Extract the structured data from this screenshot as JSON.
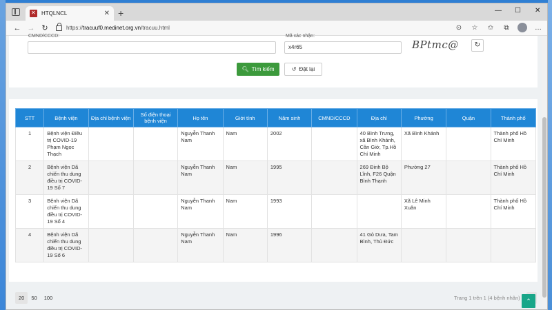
{
  "browser": {
    "tab_title": "HTQLNCL",
    "url_prefix": "https://",
    "url_host": "tracuuf0.medinet.org.vn",
    "url_path": "/tracuu.html",
    "win_min": "—",
    "win_max": "☐",
    "win_close": "✕"
  },
  "search_form": {
    "id_label": "CMND/CCCD:",
    "id_value": "",
    "captcha_label": "Mã xác nhận:",
    "captcha_value": "x4r65",
    "captcha_text": "BPtmc@",
    "search_button": "Tìm kiếm",
    "reset_button": "Đặt lại"
  },
  "table": {
    "headers": [
      "STT",
      "Bệnh viện",
      "Địa chỉ bệnh viện",
      "Số điện thoại bệnh viện",
      "Họ tên",
      "Giới tính",
      "Năm sinh",
      "CMND/CCCD",
      "Địa chỉ",
      "Phường",
      "Quận",
      "Thành phố"
    ],
    "rows": [
      [
        "1",
        "Bệnh viện Điều trị COVID-19 Phạm Ngọc Thạch",
        "",
        "",
        "Nguyễn Thanh Nam",
        "Nam",
        "2002",
        "",
        "40 Bình Trưng, xã Bình Khánh, Cần Giờ, Tp.Hồ Chí Minh",
        "Xã Bình Khánh",
        "",
        "Thành phố Hồ Chí Minh"
      ],
      [
        "2",
        "Bệnh viện Dã chiến thu dung điều trị COVID-19 Số 7",
        "",
        "",
        "Nguyễn Thanh Nam",
        "Nam",
        "1995",
        "",
        "269 Đinh Bộ Lĩnh, F26 Quận Bình Thạnh",
        "Phường 27",
        "",
        "Thành phố Hồ Chí Minh"
      ],
      [
        "3",
        "Bệnh viện Dã chiến thu dung điều trị COVID-19 Số 4",
        "",
        "",
        "Nguyễn Thanh Nam",
        "Nam",
        "1993",
        "",
        "",
        "Xã Lê Minh Xuân",
        "",
        "Thành phố Hồ Chí Minh"
      ],
      [
        "4",
        "Bệnh viện Dã chiến thu dung điều trị COVID-19 Số 6",
        "",
        "",
        "Nguyễn Thanh Nam",
        "Nam",
        "1996",
        "",
        "41 Gò Dưa, Tam Bình, Thủ Đức",
        "",
        "",
        ""
      ]
    ]
  },
  "pagination": {
    "sizes": [
      "20",
      "50",
      "100"
    ],
    "info": "Trang 1 trên 1 (4 bệnh nhân)",
    "page": "1"
  },
  "colors": {
    "header_blue": "#1f86d6",
    "search_green": "#3c9a3c",
    "to_top_teal": "#18a689"
  }
}
